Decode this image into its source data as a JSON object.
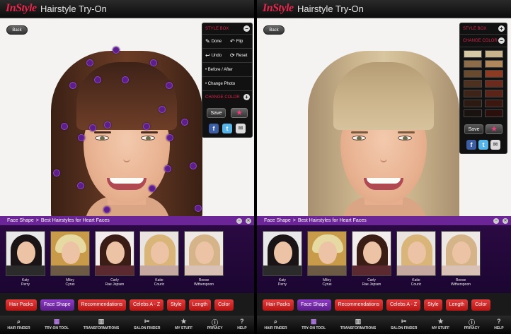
{
  "panels": [
    {
      "header": {
        "logo": "InStyle",
        "title": "Hairstyle Try-On"
      },
      "back_label": "Back",
      "style_panel": {
        "title": "STYLE BOX",
        "done": "Done",
        "flip": "Flip",
        "undo": "Undo",
        "reset": "Reset",
        "before_after": "• Before / After",
        "change_photo": "• Change Photo",
        "change_color": "CHANGE COLOR",
        "save": "Save"
      },
      "strip": {
        "crumb1": "Face Shape",
        "crumb2": "Best Hairstyles for Heart Faces"
      }
    },
    {
      "header": {
        "logo": "InStyle",
        "title": "Hairstyle Try-On"
      },
      "back_label": "Back",
      "style_panel": {
        "title": "STYLE BOX",
        "change_color": "CHANGE COLOR",
        "save": "Save"
      },
      "strip": {
        "crumb1": "Face Shape",
        "crumb2": "Best Hairstyles for Heart Faces"
      }
    }
  ],
  "celebrities": [
    {
      "line1": "Katy",
      "line2": "Perry"
    },
    {
      "line1": "Miley",
      "line2": "Cyrus"
    },
    {
      "line1": "Carly",
      "line2": "Rae Jepsen"
    },
    {
      "line1": "Katie",
      "line2": "Couric"
    },
    {
      "line1": "Reese",
      "line2": "Witherspoon"
    }
  ],
  "tabs": [
    "Hair Packs",
    "Face Shape",
    "Recommendations",
    "Celebs A - Z",
    "Style",
    "Length",
    "Color"
  ],
  "active_tab": "Face Shape",
  "bottom_nav": [
    "HAIR FINDER",
    "TRY-ON TOOL",
    "TRANSFORMATIONS",
    "SALON FINDER",
    "MY STUFF",
    "PRIVACY",
    "HELP"
  ],
  "active_nav": "TRY-ON TOOL",
  "nav_icons": [
    "search-icon",
    "mirror-icon",
    "transformations-icon",
    "scissors-icon",
    "star-icon",
    "info-icon",
    "help-icon"
  ],
  "colors": {
    "brand_red": "#e5264c",
    "accent_purple": "#6c2596",
    "tab_red": "#c91c1c",
    "hair_brown": "#4a2b1d",
    "hair_blonde": "#c9b38c"
  },
  "hair_swatches": [
    "#d8c9a6",
    "#c9b38c",
    "#8d6d49",
    "#b0885c",
    "#6a4a2e",
    "#8c3a22",
    "#4e3020",
    "#6b2b1c",
    "#3e2418",
    "#5a2418",
    "#2c1a12",
    "#3b1710",
    "#1a120e",
    "#2a0f0c"
  ]
}
